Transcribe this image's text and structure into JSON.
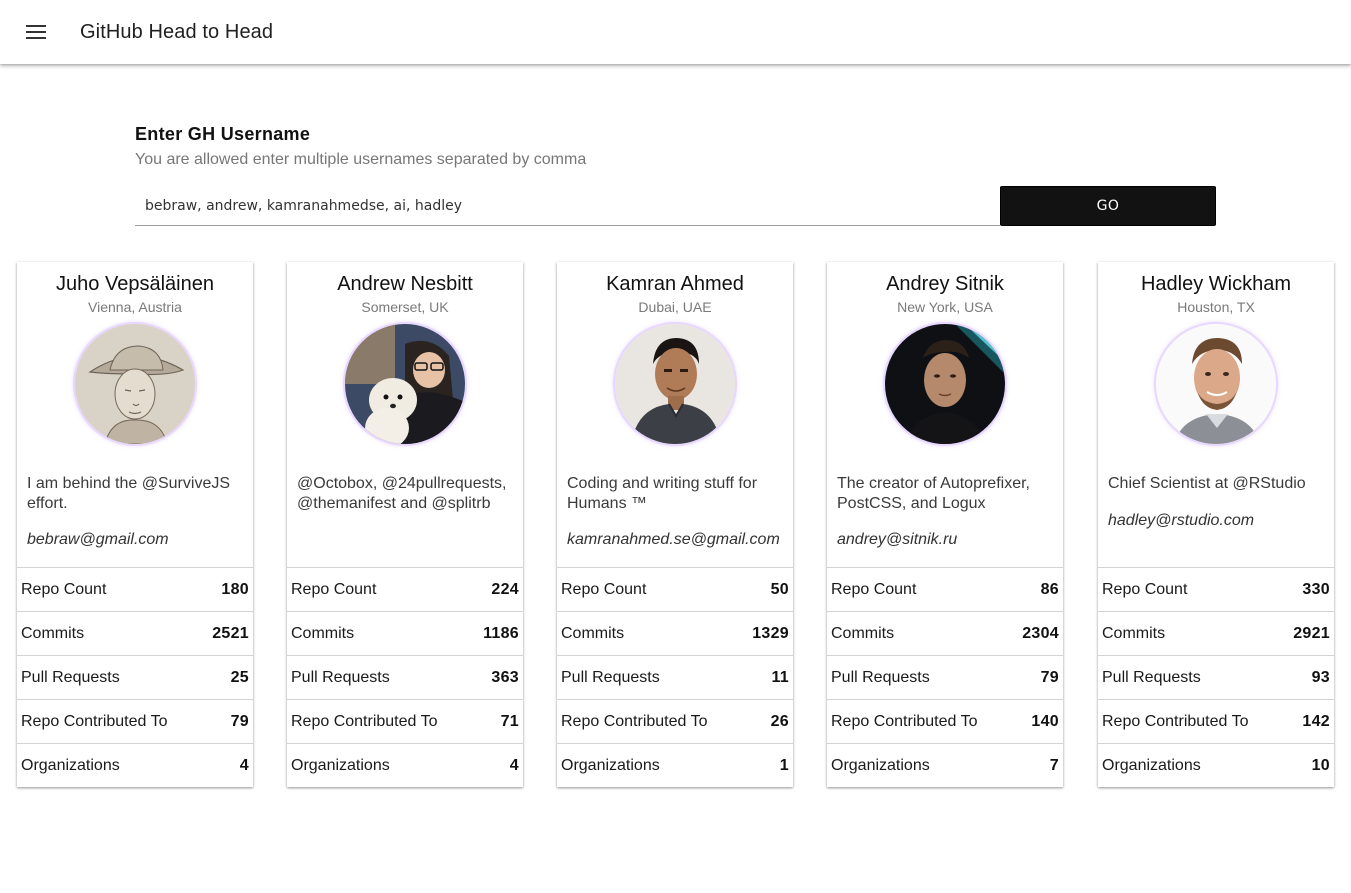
{
  "appbar": {
    "menu_icon": "hamburger-menu-icon",
    "title": "GitHub Head to Head"
  },
  "search": {
    "heading": "Enter GH Username",
    "subtitle": "You are allowed enter multiple usernames separated by comma",
    "value": "bebraw, andrew, kamranahmedse, ai, hadley",
    "button_label": "GO"
  },
  "stat_labels": {
    "repo_count": "Repo Count",
    "commits": "Commits",
    "pull_requests": "Pull Requests",
    "repo_contributed_to": "Repo Contributed To",
    "organizations": "Organizations"
  },
  "colors": {
    "accent_glow": "#e8d7ff",
    "button_bg": "#121212",
    "divider": "#d3d3d3"
  },
  "users": [
    {
      "name": "Juho Vepsäläinen",
      "location": "Vienna, Austria",
      "bio": "I am behind the @SurviveJS effort.",
      "email": "bebraw@gmail.com",
      "stats": {
        "repo_count": "180",
        "commits": "2521",
        "pull_requests": "25",
        "repo_contributed_to": "79",
        "organizations": "4"
      }
    },
    {
      "name": "Andrew Nesbitt",
      "location": "Somerset, UK",
      "bio": "@Octobox, @24pullrequests, @themanifest and @splitrb",
      "email": "",
      "stats": {
        "repo_count": "224",
        "commits": "1186",
        "pull_requests": "363",
        "repo_contributed_to": "71",
        "organizations": "4"
      }
    },
    {
      "name": "Kamran Ahmed",
      "location": "Dubai, UAE",
      "bio": "Coding and writing stuff for Humans ™",
      "email": "kamranahmed.se@gmail.com",
      "stats": {
        "repo_count": "50",
        "commits": "1329",
        "pull_requests": "11",
        "repo_contributed_to": "26",
        "organizations": "1"
      }
    },
    {
      "name": "Andrey Sitnik",
      "location": "New York, USA",
      "bio": "The creator of Autoprefixer, PostCSS, and Logux",
      "email": "andrey@sitnik.ru",
      "stats": {
        "repo_count": "86",
        "commits": "2304",
        "pull_requests": "79",
        "repo_contributed_to": "140",
        "organizations": "7"
      }
    },
    {
      "name": "Hadley Wickham",
      "location": "Houston, TX",
      "bio": "Chief Scientist at @RStudio",
      "email": "hadley@rstudio.com",
      "stats": {
        "repo_count": "330",
        "commits": "2921",
        "pull_requests": "93",
        "repo_contributed_to": "142",
        "organizations": "10"
      }
    }
  ]
}
